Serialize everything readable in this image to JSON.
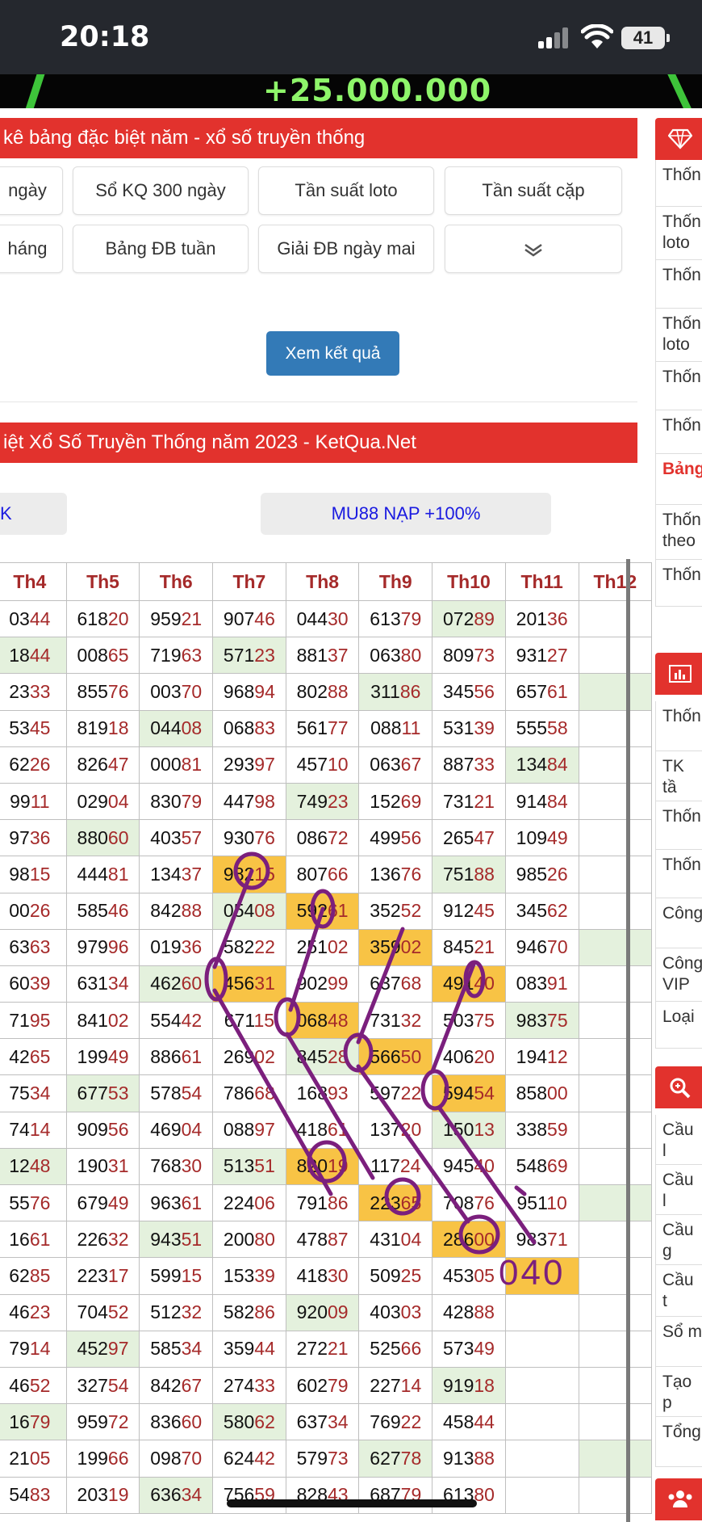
{
  "status": {
    "time": "20:18",
    "battery": "41"
  },
  "banner": {
    "amount": "+25.000.000"
  },
  "section1": {
    "title": "kê bảng đặc biệt năm - xổ số truyền thống"
  },
  "nav_buttons": [
    {
      "label": "ngày"
    },
    {
      "label": "Sổ KQ 300 ngày"
    },
    {
      "label": "Tần suất loto"
    },
    {
      "label": "Tần suất cặp"
    },
    {
      "label": "háng"
    },
    {
      "label": "Bảng ĐB tuần"
    },
    {
      "label": "Giải ĐB ngày mai"
    }
  ],
  "submit_label": "Xem kết quả",
  "section2": {
    "title": "iệt Xổ Số Truyền Thống năm 2023 - KetQua.Net"
  },
  "promos": [
    {
      "label": "K"
    },
    {
      "label": "MU88 NẠP +100%"
    }
  ],
  "table": {
    "headers": [
      "Th4",
      "Th5",
      "Th6",
      "Th7",
      "Th8",
      "Th9",
      "Th10",
      "Th11",
      "Th12"
    ],
    "rows": [
      [
        {
          "v": "03",
          "t": "44"
        },
        {
          "v": "618",
          "t": "20"
        },
        {
          "v": "959",
          "t": "21"
        },
        {
          "v": "907",
          "t": "46"
        },
        {
          "v": "044",
          "t": "30"
        },
        {
          "v": "613",
          "t": "79"
        },
        {
          "v": "072",
          "t": "89",
          "c": "g"
        },
        {
          "v": "201",
          "t": "36"
        },
        {
          "v": "",
          "t": ""
        }
      ],
      [
        {
          "v": "18",
          "t": "44",
          "c": "g"
        },
        {
          "v": "008",
          "t": "65"
        },
        {
          "v": "719",
          "t": "63"
        },
        {
          "v": "571",
          "t": "23",
          "c": "g"
        },
        {
          "v": "881",
          "t": "37"
        },
        {
          "v": "063",
          "t": "80"
        },
        {
          "v": "809",
          "t": "73"
        },
        {
          "v": "931",
          "t": "27"
        },
        {
          "v": "",
          "t": ""
        }
      ],
      [
        {
          "v": "23",
          "t": "33"
        },
        {
          "v": "855",
          "t": "76"
        },
        {
          "v": "003",
          "t": "70"
        },
        {
          "v": "968",
          "t": "94"
        },
        {
          "v": "802",
          "t": "88"
        },
        {
          "v": "311",
          "t": "86",
          "c": "g"
        },
        {
          "v": "345",
          "t": "56"
        },
        {
          "v": "657",
          "t": "61"
        },
        {
          "v": "",
          "t": "",
          "c": "g"
        }
      ],
      [
        {
          "v": "53",
          "t": "45"
        },
        {
          "v": "819",
          "t": "18"
        },
        {
          "v": "044",
          "t": "08",
          "c": "g"
        },
        {
          "v": "068",
          "t": "83"
        },
        {
          "v": "561",
          "t": "77"
        },
        {
          "v": "088",
          "t": "11"
        },
        {
          "v": "531",
          "t": "39"
        },
        {
          "v": "555",
          "t": "58"
        },
        {
          "v": "",
          "t": ""
        }
      ],
      [
        {
          "v": "62",
          "t": "26"
        },
        {
          "v": "826",
          "t": "47"
        },
        {
          "v": "000",
          "t": "81"
        },
        {
          "v": "293",
          "t": "97"
        },
        {
          "v": "457",
          "t": "10"
        },
        {
          "v": "063",
          "t": "67"
        },
        {
          "v": "887",
          "t": "33"
        },
        {
          "v": "134",
          "t": "84",
          "c": "g"
        },
        {
          "v": "",
          "t": ""
        }
      ],
      [
        {
          "v": "99",
          "t": "11"
        },
        {
          "v": "029",
          "t": "04"
        },
        {
          "v": "830",
          "t": "79"
        },
        {
          "v": "447",
          "t": "98"
        },
        {
          "v": "749",
          "t": "23",
          "c": "g"
        },
        {
          "v": "152",
          "t": "69"
        },
        {
          "v": "731",
          "t": "21"
        },
        {
          "v": "914",
          "t": "84"
        },
        {
          "v": "",
          "t": ""
        }
      ],
      [
        {
          "v": "97",
          "t": "36"
        },
        {
          "v": "880",
          "t": "60",
          "c": "g"
        },
        {
          "v": "403",
          "t": "57"
        },
        {
          "v": "930",
          "t": "76"
        },
        {
          "v": "086",
          "t": "72"
        },
        {
          "v": "499",
          "t": "56"
        },
        {
          "v": "265",
          "t": "47"
        },
        {
          "v": "109",
          "t": "49"
        },
        {
          "v": "",
          "t": ""
        }
      ],
      [
        {
          "v": "98",
          "t": "15"
        },
        {
          "v": "444",
          "t": "81"
        },
        {
          "v": "134",
          "t": "37"
        },
        {
          "v": "982",
          "t": "15",
          "c": "o"
        },
        {
          "v": "807",
          "t": "66"
        },
        {
          "v": "136",
          "t": "76"
        },
        {
          "v": "751",
          "t": "88",
          "c": "g"
        },
        {
          "v": "985",
          "t": "26"
        },
        {
          "v": "",
          "t": ""
        }
      ],
      [
        {
          "v": "00",
          "t": "26"
        },
        {
          "v": "585",
          "t": "46"
        },
        {
          "v": "842",
          "t": "88"
        },
        {
          "v": "054",
          "t": "08",
          "c": "g"
        },
        {
          "v": "592",
          "t": "61",
          "c": "o"
        },
        {
          "v": "352",
          "t": "52"
        },
        {
          "v": "912",
          "t": "45"
        },
        {
          "v": "345",
          "t": "62"
        },
        {
          "v": "",
          "t": ""
        }
      ],
      [
        {
          "v": "63",
          "t": "63"
        },
        {
          "v": "979",
          "t": "96"
        },
        {
          "v": "019",
          "t": "36"
        },
        {
          "v": "582",
          "t": "22"
        },
        {
          "v": "251",
          "t": "02"
        },
        {
          "v": "359",
          "t": "02",
          "c": "o"
        },
        {
          "v": "845",
          "t": "21"
        },
        {
          "v": "946",
          "t": "70"
        },
        {
          "v": "",
          "t": "",
          "c": "g"
        }
      ],
      [
        {
          "v": "60",
          "t": "39"
        },
        {
          "v": "631",
          "t": "34"
        },
        {
          "v": "462",
          "t": "60",
          "c": "g"
        },
        {
          "v": "456",
          "t": "31",
          "c": "o"
        },
        {
          "v": "902",
          "t": "99"
        },
        {
          "v": "637",
          "t": "68"
        },
        {
          "v": "491",
          "t": "40",
          "c": "o"
        },
        {
          "v": "083",
          "t": "91"
        },
        {
          "v": "",
          "t": ""
        }
      ],
      [
        {
          "v": "71",
          "t": "95"
        },
        {
          "v": "841",
          "t": "02"
        },
        {
          "v": "554",
          "t": "42"
        },
        {
          "v": "671",
          "t": "15"
        },
        {
          "v": "068",
          "t": "48",
          "c": "o"
        },
        {
          "v": "731",
          "t": "32"
        },
        {
          "v": "503",
          "t": "75"
        },
        {
          "v": "983",
          "t": "75",
          "c": "g"
        },
        {
          "v": "",
          "t": ""
        }
      ],
      [
        {
          "v": "42",
          "t": "65"
        },
        {
          "v": "199",
          "t": "49"
        },
        {
          "v": "886",
          "t": "61"
        },
        {
          "v": "269",
          "t": "02"
        },
        {
          "v": "845",
          "t": "28",
          "c": "g"
        },
        {
          "v": "566",
          "t": "50",
          "c": "o"
        },
        {
          "v": "406",
          "t": "20"
        },
        {
          "v": "194",
          "t": "12"
        },
        {
          "v": "",
          "t": ""
        }
      ],
      [
        {
          "v": "75",
          "t": "34"
        },
        {
          "v": "677",
          "t": "53",
          "c": "g"
        },
        {
          "v": "578",
          "t": "54"
        },
        {
          "v": "786",
          "t": "68"
        },
        {
          "v": "168",
          "t": "93"
        },
        {
          "v": "597",
          "t": "22"
        },
        {
          "v": "594",
          "t": "54",
          "c": "o"
        },
        {
          "v": "858",
          "t": "00"
        },
        {
          "v": "",
          "t": ""
        }
      ],
      [
        {
          "v": "74",
          "t": "14"
        },
        {
          "v": "909",
          "t": "56"
        },
        {
          "v": "469",
          "t": "04"
        },
        {
          "v": "088",
          "t": "97"
        },
        {
          "v": "418",
          "t": "61"
        },
        {
          "v": "137",
          "t": "20"
        },
        {
          "v": "150",
          "t": "13",
          "c": "g"
        },
        {
          "v": "338",
          "t": "59"
        },
        {
          "v": "",
          "t": ""
        }
      ],
      [
        {
          "v": "12",
          "t": "48",
          "c": "g"
        },
        {
          "v": "190",
          "t": "31"
        },
        {
          "v": "768",
          "t": "30"
        },
        {
          "v": "513",
          "t": "51",
          "c": "g"
        },
        {
          "v": "820",
          "t": "19",
          "c": "o"
        },
        {
          "v": "117",
          "t": "24"
        },
        {
          "v": "945",
          "t": "40"
        },
        {
          "v": "548",
          "t": "69"
        },
        {
          "v": "",
          "t": ""
        }
      ],
      [
        {
          "v": "55",
          "t": "76"
        },
        {
          "v": "679",
          "t": "49"
        },
        {
          "v": "963",
          "t": "61"
        },
        {
          "v": "224",
          "t": "06"
        },
        {
          "v": "791",
          "t": "86"
        },
        {
          "v": "223",
          "t": "65",
          "c": "o"
        },
        {
          "v": "708",
          "t": "76"
        },
        {
          "v": "951",
          "t": "10"
        },
        {
          "v": "",
          "t": "",
          "c": "g"
        }
      ],
      [
        {
          "v": "16",
          "t": "61"
        },
        {
          "v": "226",
          "t": "32"
        },
        {
          "v": "943",
          "t": "51",
          "c": "g"
        },
        {
          "v": "200",
          "t": "80"
        },
        {
          "v": "478",
          "t": "87"
        },
        {
          "v": "431",
          "t": "04"
        },
        {
          "v": "286",
          "t": "00",
          "c": "o"
        },
        {
          "v": "983",
          "t": "71"
        },
        {
          "v": "",
          "t": ""
        }
      ],
      [
        {
          "v": "62",
          "t": "85"
        },
        {
          "v": "223",
          "t": "17"
        },
        {
          "v": "599",
          "t": "15"
        },
        {
          "v": "153",
          "t": "39"
        },
        {
          "v": "418",
          "t": "30"
        },
        {
          "v": "509",
          "t": "25"
        },
        {
          "v": "453",
          "t": "05"
        },
        {
          "v": "",
          "t": "",
          "c": "o"
        },
        {
          "v": "",
          "t": ""
        }
      ],
      [
        {
          "v": "46",
          "t": "23"
        },
        {
          "v": "704",
          "t": "52"
        },
        {
          "v": "512",
          "t": "32"
        },
        {
          "v": "582",
          "t": "86"
        },
        {
          "v": "920",
          "t": "09",
          "c": "g"
        },
        {
          "v": "403",
          "t": "03"
        },
        {
          "v": "428",
          "t": "88"
        },
        {
          "v": "",
          "t": ""
        },
        {
          "v": "",
          "t": ""
        }
      ],
      [
        {
          "v": "79",
          "t": "14"
        },
        {
          "v": "452",
          "t": "97",
          "c": "g"
        },
        {
          "v": "585",
          "t": "34"
        },
        {
          "v": "359",
          "t": "44"
        },
        {
          "v": "272",
          "t": "21"
        },
        {
          "v": "525",
          "t": "66"
        },
        {
          "v": "573",
          "t": "49"
        },
        {
          "v": "",
          "t": ""
        },
        {
          "v": "",
          "t": ""
        }
      ],
      [
        {
          "v": "46",
          "t": "52"
        },
        {
          "v": "327",
          "t": "54"
        },
        {
          "v": "842",
          "t": "67"
        },
        {
          "v": "274",
          "t": "33"
        },
        {
          "v": "602",
          "t": "79"
        },
        {
          "v": "227",
          "t": "14"
        },
        {
          "v": "919",
          "t": "18",
          "c": "g"
        },
        {
          "v": "",
          "t": ""
        },
        {
          "v": "",
          "t": ""
        }
      ],
      [
        {
          "v": "16",
          "t": "79",
          "c": "g"
        },
        {
          "v": "959",
          "t": "72"
        },
        {
          "v": "836",
          "t": "60"
        },
        {
          "v": "580",
          "t": "62",
          "c": "g"
        },
        {
          "v": "637",
          "t": "34"
        },
        {
          "v": "769",
          "t": "22"
        },
        {
          "v": "458",
          "t": "44"
        },
        {
          "v": "",
          "t": ""
        },
        {
          "v": "",
          "t": ""
        }
      ],
      [
        {
          "v": "21",
          "t": "05"
        },
        {
          "v": "199",
          "t": "66"
        },
        {
          "v": "098",
          "t": "70"
        },
        {
          "v": "624",
          "t": "42"
        },
        {
          "v": "579",
          "t": "73"
        },
        {
          "v": "627",
          "t": "78",
          "c": "g"
        },
        {
          "v": "913",
          "t": "88"
        },
        {
          "v": "",
          "t": ""
        },
        {
          "v": "",
          "t": "",
          "c": "g"
        }
      ],
      [
        {
          "v": "54",
          "t": "83"
        },
        {
          "v": "203",
          "t": "19"
        },
        {
          "v": "636",
          "t": "34",
          "c": "g"
        },
        {
          "v": "756",
          "t": "59"
        },
        {
          "v": "828",
          "t": "43"
        },
        {
          "v": "687",
          "t": "79"
        },
        {
          "v": "613",
          "t": "80"
        },
        {
          "v": "",
          "t": ""
        },
        {
          "v": "",
          "t": ""
        }
      ]
    ]
  },
  "annotation_text": "040",
  "sidebar": {
    "items_top": [
      {
        "label": "Thốn"
      },
      {
        "label": "Thốn loto"
      },
      {
        "label": "Thốn"
      },
      {
        "label": "Thốn loto"
      },
      {
        "label": "Thốn"
      },
      {
        "label": "Thốn"
      },
      {
        "label": "Bảng"
      },
      {
        "label": "Thốn theo"
      },
      {
        "label": "Thốn"
      }
    ],
    "items_mid": [
      {
        "label": "Thốn"
      },
      {
        "label": "TK tầ"
      },
      {
        "label": "Thốn"
      },
      {
        "label": "Thốn"
      },
      {
        "label": "Công"
      },
      {
        "label": "Công VIP"
      },
      {
        "label": "Loại"
      }
    ],
    "items_bottom": [
      {
        "label": "Cầu l"
      },
      {
        "label": "Cầu l"
      },
      {
        "label": "Cầu g"
      },
      {
        "label": "Cầu t"
      },
      {
        "label": "Sổ m"
      },
      {
        "label": "Tạo p"
      },
      {
        "label": "Tổng"
      }
    ]
  },
  "colors": {
    "accent_red": "#e2322d",
    "button_blue": "#337ab7",
    "highlight_orange": "#f8c345",
    "highlight_green": "#e4f1dd",
    "annotation_purple": "#7b1f7d"
  }
}
